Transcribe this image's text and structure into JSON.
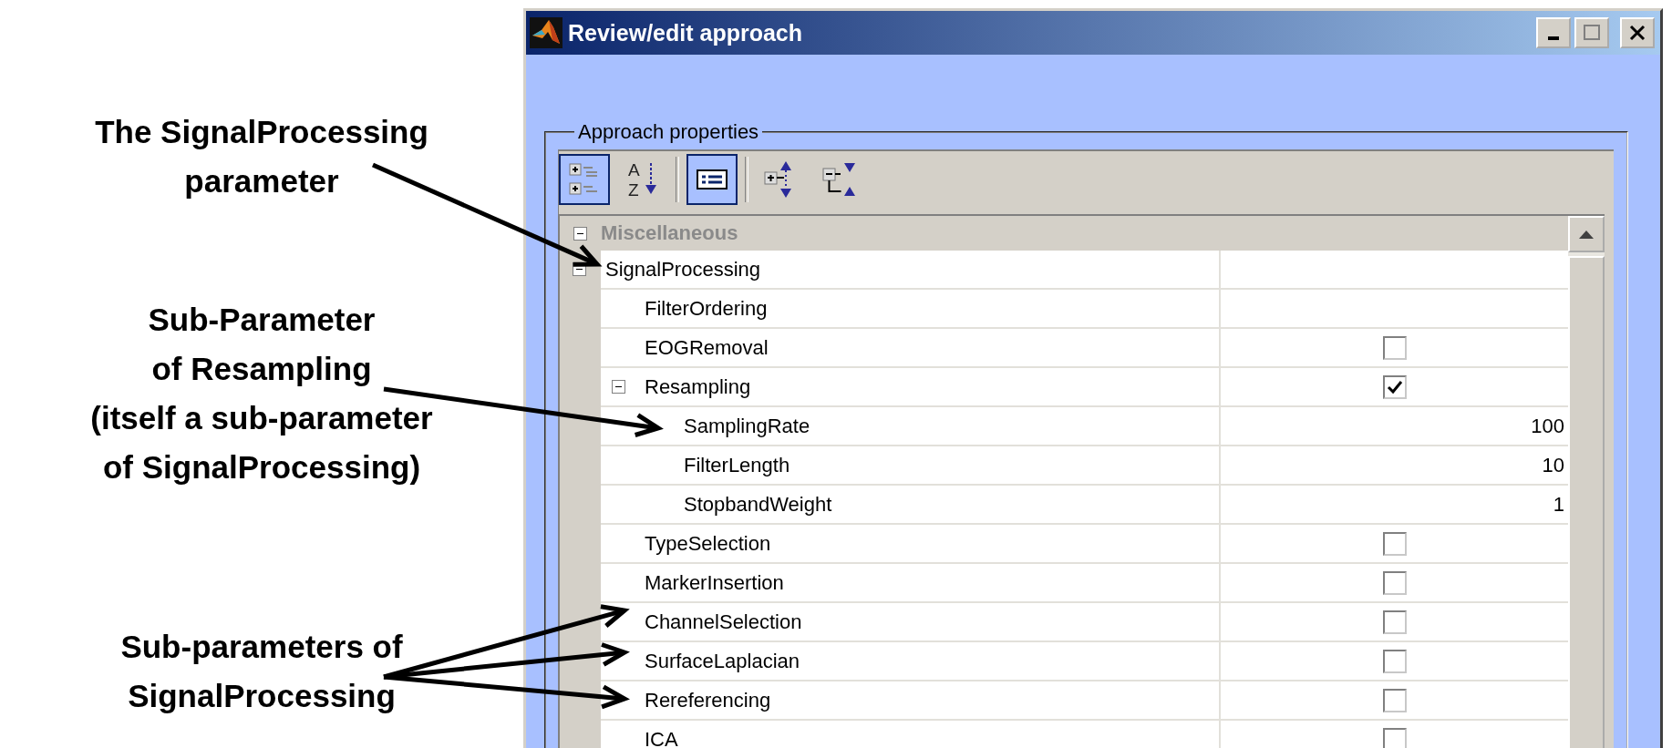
{
  "annotations": [
    {
      "lines": [
        "The SignalProcessing",
        "parameter"
      ]
    },
    {
      "lines": [
        "Sub-Parameter",
        "of Resampling",
        "(itself a sub-parameter",
        "of SignalProcessing)"
      ]
    },
    {
      "lines": [
        "Sub-parameters of",
        "SignalProcessing"
      ]
    }
  ],
  "window": {
    "title": "Review/edit approach"
  },
  "group_label": "Approach properties",
  "toolbar_groups": [
    {
      "tools": [
        {
          "kind": "categorized",
          "selected": true
        },
        {
          "kind": "alphabetical",
          "letters": [
            "A",
            "Z"
          ],
          "selected": false
        }
      ]
    },
    {
      "tools": [
        {
          "kind": "description",
          "selected": true
        }
      ]
    },
    {
      "tools": [
        {
          "kind": "expand_all",
          "selected": false
        },
        {
          "kind": "collapse_all",
          "selected": false
        }
      ]
    }
  ],
  "grid": {
    "categories": [
      {
        "name": "Miscellaneous",
        "expanded": true,
        "children": [
          {
            "name": "SignalProcessing",
            "kind": "empty",
            "expanded": true,
            "children": [
              {
                "name": "FilterOrdering",
                "kind": "empty"
              },
              {
                "name": "EOGRemoval",
                "kind": "checkbox",
                "checked": false
              },
              {
                "name": "Resampling",
                "kind": "checkbox",
                "checked": true,
                "expanded": true,
                "children": [
                  {
                    "name": "SamplingRate",
                    "kind": "number",
                    "value": "100"
                  },
                  {
                    "name": "FilterLength",
                    "kind": "number",
                    "value": "10"
                  },
                  {
                    "name": "StopbandWeight",
                    "kind": "number",
                    "value": "1"
                  }
                ]
              },
              {
                "name": "TypeSelection",
                "kind": "checkbox",
                "checked": false
              },
              {
                "name": "MarkerInsertion",
                "kind": "checkbox",
                "checked": false
              },
              {
                "name": "ChannelSelection",
                "kind": "checkbox",
                "checked": false
              },
              {
                "name": "SurfaceLaplacian",
                "kind": "checkbox",
                "checked": false
              },
              {
                "name": "Rereferencing",
                "kind": "checkbox",
                "checked": false
              },
              {
                "name": "ICA",
                "kind": "checkbox",
                "checked": false
              }
            ]
          }
        ]
      }
    ]
  }
}
